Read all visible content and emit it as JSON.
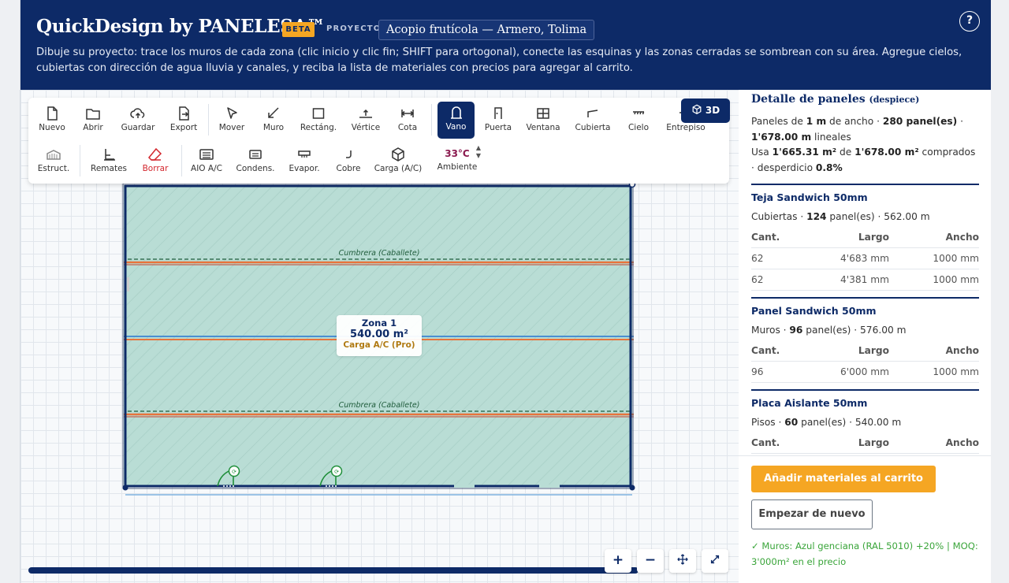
{
  "header": {
    "title": "QuickDesign by PANELESA™",
    "beta": "BETA",
    "project_label": "PROYECTO",
    "project_name": "Acopio frutícola — Armero, Tolima",
    "help": "?",
    "instructions": "Dibuje su proyecto: trace los muros de cada zona (clic inicio y clic fin; SHIFT para ortogonal), conecte las esquinas y las zonas cerradas se sombrean con su área. Agregue cielos, cubiertas con dirección de agua lluvia y canales, y reciba la lista de materiales con precios para agregar al carrito."
  },
  "toolbar": {
    "row1": [
      {
        "label": "Nuevo",
        "icon": "file-icon"
      },
      {
        "label": "Abrir",
        "icon": "folder-icon"
      },
      {
        "label": "Guardar",
        "icon": "cloud-upload-icon"
      },
      {
        "label": "Export",
        "icon": "export-icon"
      },
      {
        "label": "Mover",
        "icon": "cursor-icon"
      },
      {
        "label": "Muro",
        "icon": "line-icon"
      },
      {
        "label": "Rectáng.",
        "icon": "rectangle-icon"
      },
      {
        "label": "Vértice",
        "icon": "vertex-icon"
      },
      {
        "label": "Cota",
        "icon": "dimension-icon"
      },
      {
        "label": "Vano",
        "icon": "opening-icon"
      },
      {
        "label": "Puerta",
        "icon": "door-icon"
      },
      {
        "label": "Ventana",
        "icon": "window-icon"
      },
      {
        "label": "Cubierta",
        "icon": "roof-icon"
      },
      {
        "label": "Cielo",
        "icon": "ceiling-icon"
      },
      {
        "label": "Entrepiso",
        "icon": "mezzanine-icon"
      }
    ],
    "row2": [
      {
        "label": "Estruct.",
        "icon": "structure-icon"
      },
      {
        "label": "Remates",
        "icon": "trim-icon"
      },
      {
        "label": "Borrar",
        "icon": "eraser-icon"
      },
      {
        "label": "AIO A/C",
        "icon": "ac-unit-icon"
      },
      {
        "label": "Condens.",
        "icon": "condenser-icon"
      },
      {
        "label": "Evapor.",
        "icon": "evaporator-icon"
      },
      {
        "label": "Cobre",
        "icon": "copper-pipe-icon"
      },
      {
        "label": "Carga (A/C)",
        "icon": "cube-icon"
      }
    ],
    "ambient_temp": "33°C",
    "ambient_label": "Ambiente",
    "view_3d": "3D"
  },
  "canvas": {
    "ridge_label_1": "Cumbrera (Caballete)",
    "ridge_label_2": "Cumbrera (Caballete)",
    "zone": {
      "name": "Zona 1",
      "area": "540.00 m²",
      "load": "Carga A/C (Pro)"
    },
    "zoom_in": "+",
    "zoom_out": "−"
  },
  "sidebar": {
    "title": "Detalle de paneles",
    "title_suffix": "(despiece)",
    "summary": {
      "p1": "Paneles de ",
      "b1": "1 m",
      "p2": " de ancho · ",
      "b2": "280 panel(es)",
      "p3": " · ",
      "b3": "1'678.00 m",
      "p4": " lineales",
      "p5": "Usa ",
      "b4": "1'665.31 m²",
      "p6": " de ",
      "b5": "1'678.00 m²",
      "p7": " comprados · desperdicio ",
      "b6": "0.8%"
    },
    "columns": [
      "Cant.",
      "Largo",
      "Ancho"
    ],
    "sections": [
      {
        "title": "Teja Sandwich 50mm",
        "sub_prefix": "Cubiertas · ",
        "sub_bold": "124",
        "sub_suffix": " panel(es) · 562.00 m",
        "rows": [
          {
            "cant": "62",
            "largo": "4'683 mm",
            "ancho": "1000 mm"
          },
          {
            "cant": "62",
            "largo": "4'381 mm",
            "ancho": "1000 mm"
          }
        ]
      },
      {
        "title": "Panel Sandwich 50mm",
        "sub_prefix": "Muros · ",
        "sub_bold": "96",
        "sub_suffix": " panel(es) · 576.00 m",
        "rows": [
          {
            "cant": "96",
            "largo": "6'000 mm",
            "ancho": "1000 mm"
          }
        ]
      },
      {
        "title": "Placa Aislante 50mm",
        "sub_prefix": "Pisos · ",
        "sub_bold": "60",
        "sub_suffix": " panel(es) · 540.00 m",
        "rows": []
      }
    ],
    "add_to_cart": "Añadir materiales al carrito",
    "restart": "Empezar de nuevo",
    "note": "✓ Muros: Azul genciana (RAL 5010) +20% | MOQ: 3'000m² en el precio"
  },
  "colors": {
    "brand_navy": "#0d2a67",
    "accent_orange": "#f5a623",
    "zone_fill": "#b9ddd5",
    "danger_red": "#d3262d",
    "success_green": "#3aa53a"
  }
}
